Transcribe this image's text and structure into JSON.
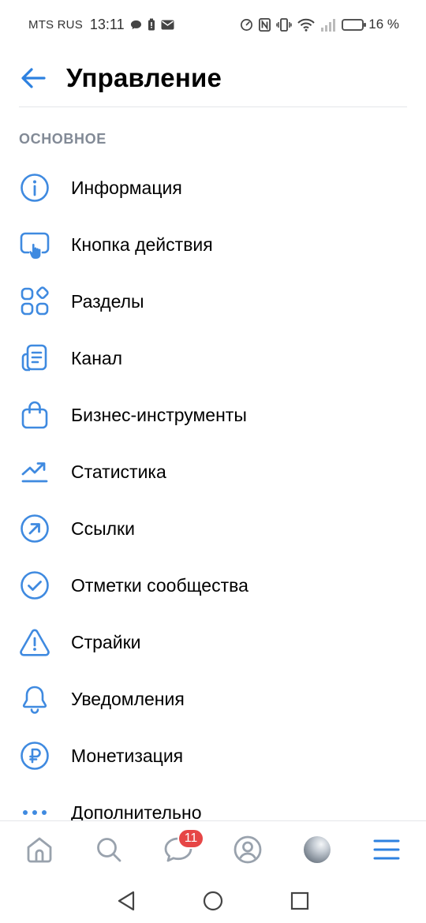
{
  "status_bar": {
    "carrier": "MTS RUS",
    "time": "13:11",
    "battery_percent": "16 %",
    "battery_level": 0.16,
    "icons": [
      "chat-bubble-icon",
      "battery-saver-icon",
      "mail-icon",
      "data-saver-icon",
      "nfc-icon",
      "vibrate-icon",
      "wifi-icon",
      "signal-icon",
      "battery-icon"
    ]
  },
  "header": {
    "back_icon": "arrow-left-icon",
    "title": "Управление"
  },
  "section": {
    "title": "ОСНОВНОЕ"
  },
  "menu": {
    "items": [
      {
        "label": "Информация",
        "icon": "info-icon"
      },
      {
        "label": "Кнопка действия",
        "icon": "action-button-icon"
      },
      {
        "label": "Разделы",
        "icon": "sections-icon"
      },
      {
        "label": "Канал",
        "icon": "channel-icon"
      },
      {
        "label": "Бизнес-инструменты",
        "icon": "shopping-bag-icon"
      },
      {
        "label": "Статистика",
        "icon": "chart-trend-icon"
      },
      {
        "label": "Ссылки",
        "icon": "link-arrow-icon"
      },
      {
        "label": "Отметки сообщества",
        "icon": "check-circle-icon"
      },
      {
        "label": "Страйки",
        "icon": "warning-icon"
      },
      {
        "label": "Уведомления",
        "icon": "bell-icon"
      },
      {
        "label": "Монетизация",
        "icon": "ruble-icon"
      },
      {
        "label": "Дополнительно",
        "icon": "more-dots-icon"
      }
    ]
  },
  "bottom_nav": {
    "items": [
      "home-icon",
      "search-icon",
      "messages-icon",
      "profile-icon",
      "avatar",
      "menu-icon"
    ],
    "messages_badge": "11"
  },
  "colors": {
    "accent": "#2d81e0",
    "icon_blue": "#3f8ae0",
    "section_gray": "#828a96",
    "badge_red": "#e64646",
    "nav_gray": "#99a2ad"
  }
}
